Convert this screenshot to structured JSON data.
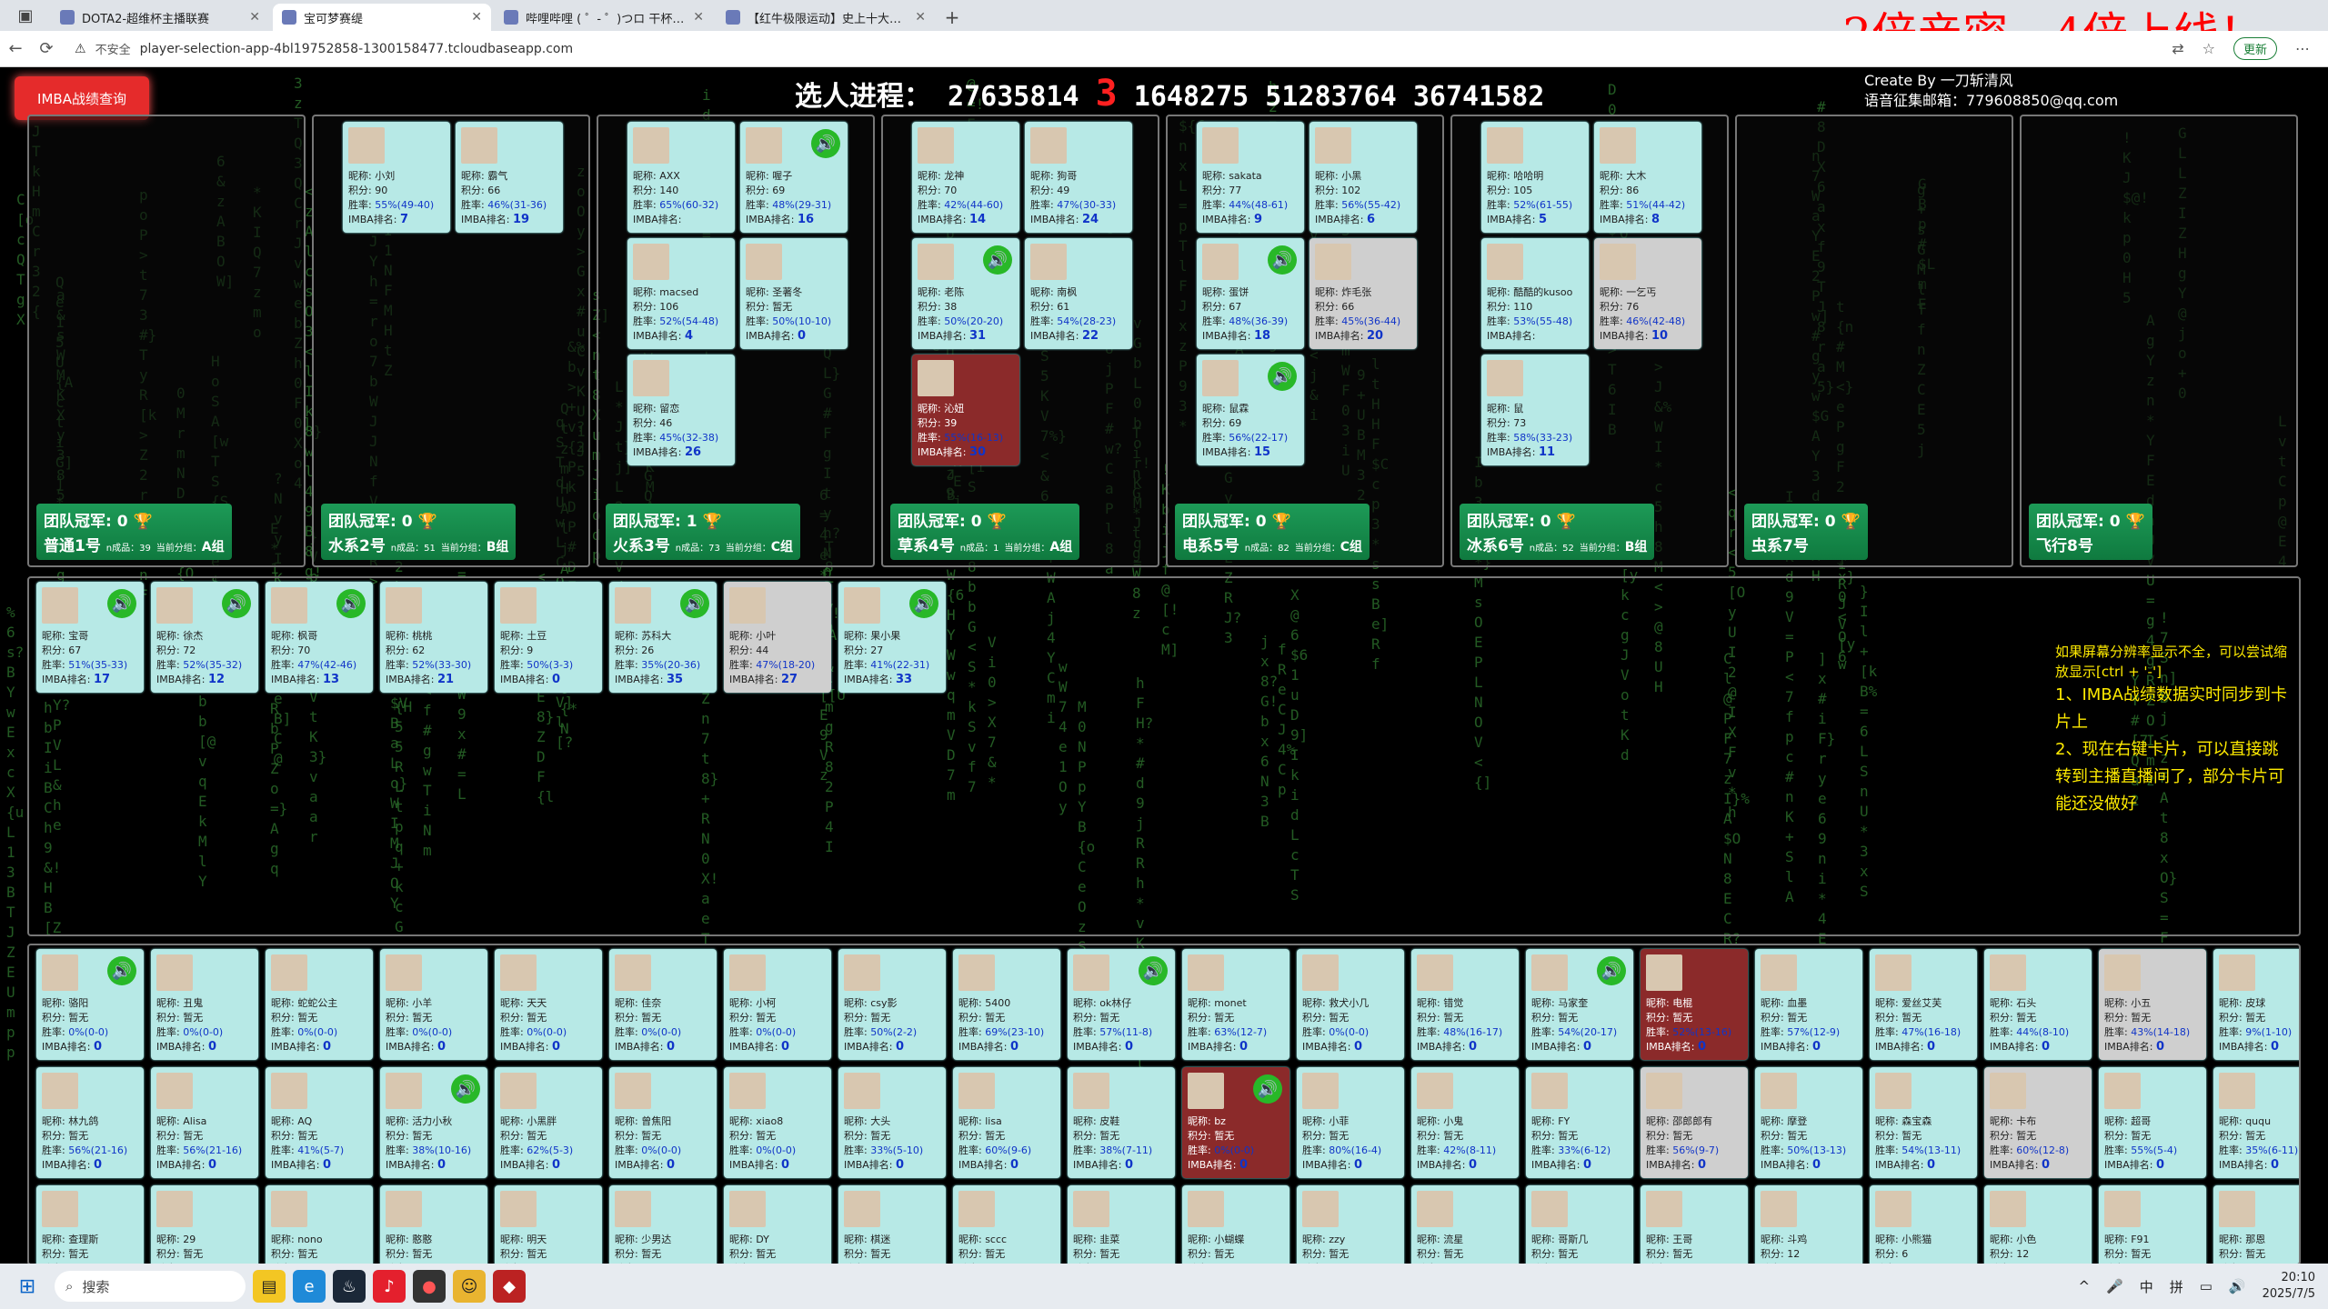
{
  "browser": {
    "tabs": [
      {
        "title": "DOTA2-超维杯主播联赛",
        "active": false
      },
      {
        "title": "宝可梦赛缇",
        "active": true
      },
      {
        "title": "哔哩哔哩 ( ゜- ゜)つロ 干杯~-bilibili",
        "active": false
      },
      {
        "title": "【红牛极限运动】史上十大世界纪录",
        "active": false
      }
    ],
    "new_tab": "+",
    "insecure": "不安全",
    "url": "player-selection-app-4bl19752858-1300158477.tcloudbaseapp.com",
    "update": "更新"
  },
  "overlay": {
    "promo": "2倍亲密，4倍上线！"
  },
  "header": {
    "imba_button": "IMBA战绩查询",
    "progress_label": "选人进程：",
    "progress_a": "27635814",
    "progress_hi": "3",
    "progress_b": "1648275 51283764 36741582",
    "credit1": "Create By 一刀斩清风",
    "credit2": "语音征集邮箱：779608850@qq.com"
  },
  "teams": [
    {
      "champ": "团队冠军: 0",
      "name": "普通1号",
      "score": "39",
      "group": "A组",
      "cards": []
    },
    {
      "champ": "团队冠军: 0",
      "name": "水系2号",
      "score": "51",
      "group": "B组",
      "cards": [
        {
          "n": "小刘",
          "s": "90",
          "w": "55%(49-40)",
          "r": "7"
        },
        {
          "n": "霸气",
          "s": "66",
          "w": "46%(31-36)",
          "r": "19"
        }
      ]
    },
    {
      "champ": "团队冠军: 1",
      "name": "火系3号",
      "score": "73",
      "group": "C组",
      "cards": [
        {
          "n": "AXX",
          "s": "140",
          "w": "65%(60-32)",
          "r": "",
          "spk": false
        },
        {
          "n": "喔子",
          "s": "69",
          "w": "48%(29-31)",
          "r": "16",
          "spk": true
        },
        {
          "n": "macsed",
          "s": "106",
          "w": "52%(54-48)",
          "r": "4"
        },
        {
          "n": "圣著冬",
          "s": "暂无",
          "w": "50%(10-10)",
          "r": "0"
        },
        {
          "n": "留恋",
          "s": "46",
          "w": "45%(32-38)",
          "r": "26"
        }
      ]
    },
    {
      "champ": "团队冠军: 0",
      "name": "草系4号",
      "score": "1",
      "group": "A组",
      "cards": [
        {
          "n": "龙神",
          "s": "70",
          "w": "42%(44-60)",
          "r": "14"
        },
        {
          "n": "狗哥",
          "s": "49",
          "w": "47%(30-33)",
          "r": "24"
        },
        {
          "n": "老陈",
          "s": "38",
          "w": "50%(20-20)",
          "r": "31",
          "spk": true
        },
        {
          "n": "南枫",
          "s": "61",
          "w": "54%(28-23)",
          "r": "22"
        },
        {
          "n": "沁妞",
          "s": "39",
          "w": "55%(16-13)",
          "r": "30",
          "dark": true
        }
      ]
    },
    {
      "champ": "团队冠军: 0",
      "name": "电系5号",
      "score": "82",
      "group": "C组",
      "cards": [
        {
          "n": "sakata",
          "s": "77",
          "w": "44%(48-61)",
          "r": "9"
        },
        {
          "n": "小黑",
          "s": "102",
          "w": "56%(55-42)",
          "r": "6"
        },
        {
          "n": "蛋饼",
          "s": "67",
          "w": "48%(36-39)",
          "r": "18",
          "spk": true
        },
        {
          "n": "炸毛张",
          "s": "66",
          "w": "45%(36-44)",
          "r": "20",
          "gray": true
        },
        {
          "n": "鼠霖",
          "s": "69",
          "w": "56%(22-17)",
          "r": "15",
          "spk": true
        }
      ]
    },
    {
      "champ": "团队冠军: 0",
      "name": "冰系6号",
      "score": "52",
      "group": "B组",
      "cards": [
        {
          "n": "哈哈明",
          "s": "105",
          "w": "52%(61-55)",
          "r": "5"
        },
        {
          "n": "大木",
          "s": "86",
          "w": "51%(44-42)",
          "r": "8"
        },
        {
          "n": "酷酷的kusoo",
          "s": "110",
          "w": "53%(55-48)",
          "r": ""
        },
        {
          "n": "一乞丐",
          "s": "76",
          "w": "46%(42-48)",
          "r": "10",
          "gray": true
        },
        {
          "n": "鼠",
          "s": "73",
          "w": "58%(33-23)",
          "r": "11"
        }
      ]
    },
    {
      "champ": "团队冠军: 0",
      "name": "虫系7号",
      "score": "",
      "group": "",
      "cards": []
    },
    {
      "champ": "团队冠军: 0",
      "name": "飞行8号",
      "score": "",
      "group": "",
      "cards": []
    }
  ],
  "labels": {
    "nick": "昵称: ",
    "score": "积分: ",
    "win": "胜率: ",
    "rank": "IMBA排名: ",
    "score_tag": "n成品：",
    "score_tag2": "当前分组："
  },
  "pool": [
    {
      "n": "宝哥",
      "s": "67",
      "w": "51%(35-33)",
      "r": "17",
      "spk": true
    },
    {
      "n": "徐杰",
      "s": "72",
      "w": "52%(35-32)",
      "r": "12",
      "spk": true
    },
    {
      "n": "枫哥",
      "s": "70",
      "w": "47%(42-46)",
      "r": "13",
      "spk": true
    },
    {
      "n": "桃桃",
      "s": "62",
      "w": "52%(33-30)",
      "r": "21"
    },
    {
      "n": "土豆",
      "s": "9",
      "w": "50%(3-3)",
      "r": "0"
    },
    {
      "n": "苏科大",
      "s": "26",
      "w": "35%(20-36)",
      "r": "35",
      "spk": true
    },
    {
      "n": "小叶",
      "s": "44",
      "w": "47%(18-20)",
      "r": "27",
      "gray": true
    },
    {
      "n": "果小果",
      "s": "27",
      "w": "41%(22-31)",
      "r": "33",
      "spk": true
    }
  ],
  "notes": {
    "hint": "如果屏幕分辨率显示不全，可以尝试缩放显示[ctrl + '-']",
    "n1": "1、IMBA战绩数据实时同步到卡片上",
    "n2": "2、现在右键卡片，可以直接跳转到主播直播间了，部分卡片可能还没做好"
  },
  "available": [
    {
      "n": "骆阳",
      "s": "暂无",
      "w": "0%(0-0)",
      "r": "0",
      "spk": true
    },
    {
      "n": "丑鬼",
      "s": "暂无",
      "w": "0%(0-0)",
      "r": "0"
    },
    {
      "n": "蛇蛇公主",
      "s": "暂无",
      "w": "0%(0-0)",
      "r": "0"
    },
    {
      "n": "小羊",
      "s": "暂无",
      "w": "0%(0-0)",
      "r": "0"
    },
    {
      "n": "天天",
      "s": "暂无",
      "w": "0%(0-0)",
      "r": "0"
    },
    {
      "n": "佳奈",
      "s": "暂无",
      "w": "0%(0-0)",
      "r": "0"
    },
    {
      "n": "小柯",
      "s": "暂无",
      "w": "0%(0-0)",
      "r": "0"
    },
    {
      "n": "csy影",
      "s": "暂无",
      "w": "50%(2-2)",
      "r": "0"
    },
    {
      "n": "5400",
      "s": "暂无",
      "w": "69%(23-10)",
      "r": "0"
    },
    {
      "n": "ok林仔",
      "s": "暂无",
      "w": "57%(11-8)",
      "r": "0",
      "spk": true
    },
    {
      "n": "monet",
      "s": "暂无",
      "w": "63%(12-7)",
      "r": "0"
    },
    {
      "n": "救犬小几",
      "s": "暂无",
      "w": "0%(0-0)",
      "r": "0"
    },
    {
      "n": "错觉",
      "s": "暂无",
      "w": "48%(16-17)",
      "r": "0"
    },
    {
      "n": "马家奎",
      "s": "暂无",
      "w": "54%(20-17)",
      "r": "0",
      "spk": true
    },
    {
      "n": "电棍",
      "s": "暂无",
      "w": "52%(13-16)",
      "r": "0",
      "dark": true
    },
    {
      "n": "血墨",
      "s": "暂无",
      "w": "57%(12-9)",
      "r": "0"
    },
    {
      "n": "爱丝艾芙",
      "s": "暂无",
      "w": "47%(16-18)",
      "r": "0"
    },
    {
      "n": "石头",
      "s": "暂无",
      "w": "44%(8-10)",
      "r": "0"
    },
    {
      "n": "小五",
      "s": "暂无",
      "w": "43%(14-18)",
      "r": "0",
      "gray": true
    },
    {
      "n": "皮球",
      "s": "暂无",
      "w": "9%(1-10)",
      "r": "0"
    },
    {
      "n": "林九鸽",
      "s": "暂无",
      "w": "56%(21-16)",
      "r": "0"
    },
    {
      "n": "Alisa",
      "s": "暂无",
      "w": "56%(21-16)",
      "r": "0"
    },
    {
      "n": "AQ",
      "s": "暂无",
      "w": "41%(5-7)",
      "r": "0"
    },
    {
      "n": "活力小秋",
      "s": "暂无",
      "w": "38%(10-16)",
      "r": "0",
      "spk": true
    },
    {
      "n": "小黑胖",
      "s": "暂无",
      "w": "62%(5-3)",
      "r": "0"
    },
    {
      "n": "曾焦阳",
      "s": "暂无",
      "w": "0%(0-0)",
      "r": "0"
    },
    {
      "n": "xiao8",
      "s": "暂无",
      "w": "0%(0-0)",
      "r": "0"
    },
    {
      "n": "大头",
      "s": "暂无",
      "w": "33%(5-10)",
      "r": "0"
    },
    {
      "n": "lisa",
      "s": "暂无",
      "w": "60%(9-6)",
      "r": "0"
    },
    {
      "n": "皮鞋",
      "s": "暂无",
      "w": "38%(7-11)",
      "r": "0"
    },
    {
      "n": "bz",
      "s": "暂无",
      "w": "0%(0-0)",
      "r": "0",
      "dark": true,
      "spk": true
    },
    {
      "n": "小菲",
      "s": "暂无",
      "w": "80%(16-4)",
      "r": "0"
    },
    {
      "n": "小鬼",
      "s": "暂无",
      "w": "42%(8-11)",
      "r": "0"
    },
    {
      "n": "FY",
      "s": "暂无",
      "w": "33%(6-12)",
      "r": "0"
    },
    {
      "n": "邵郎郎有",
      "s": "暂无",
      "w": "56%(9-7)",
      "r": "0",
      "gray": true
    },
    {
      "n": "摩登",
      "s": "暂无",
      "w": "50%(13-13)",
      "r": "0"
    },
    {
      "n": "森宝森",
      "s": "暂无",
      "w": "54%(13-11)",
      "r": "0"
    },
    {
      "n": "卡布",
      "s": "暂无",
      "w": "60%(12-8)",
      "r": "0",
      "gray": true
    },
    {
      "n": "超哥",
      "s": "暂无",
      "w": "55%(5-4)",
      "r": "0"
    },
    {
      "n": "ququ",
      "s": "暂无",
      "w": "35%(6-11)",
      "r": "0"
    },
    {
      "n": "查理斯",
      "s": "暂无",
      "w": "",
      "r": ""
    },
    {
      "n": "29",
      "s": "暂无",
      "w": "",
      "r": ""
    },
    {
      "n": "nono",
      "s": "暂无",
      "w": "",
      "r": ""
    },
    {
      "n": "憨憨",
      "s": "暂无",
      "w": "",
      "r": ""
    },
    {
      "n": "明天",
      "s": "暂无",
      "w": "",
      "r": ""
    },
    {
      "n": "少男达",
      "s": "暂无",
      "w": "",
      "r": ""
    },
    {
      "n": "DY",
      "s": "暂无",
      "w": "",
      "r": ""
    },
    {
      "n": "棋迷",
      "s": "暂无",
      "w": "",
      "r": ""
    },
    {
      "n": "sccc",
      "s": "暂无",
      "w": "",
      "r": ""
    },
    {
      "n": "韭菜",
      "s": "暂无",
      "w": "",
      "r": ""
    },
    {
      "n": "小蝴蝶",
      "s": "暂无",
      "w": "",
      "r": ""
    },
    {
      "n": "zzy",
      "s": "暂无",
      "w": "",
      "r": ""
    },
    {
      "n": "流星",
      "s": "暂无",
      "w": "",
      "r": ""
    },
    {
      "n": "哥斯几",
      "s": "暂无",
      "w": "",
      "r": ""
    },
    {
      "n": "王哥",
      "s": "暂无",
      "w": "",
      "r": ""
    },
    {
      "n": "斗鸡",
      "s": "12",
      "w": "",
      "r": ""
    },
    {
      "n": "小熊猫",
      "s": "6",
      "w": "",
      "r": ""
    },
    {
      "n": "小色",
      "s": "12",
      "w": "",
      "r": ""
    },
    {
      "n": "F91",
      "s": "暂无",
      "w": "",
      "r": ""
    },
    {
      "n": "那恩",
      "s": "暂无",
      "w": "",
      "r": ""
    }
  ],
  "taskbar": {
    "search": "搜索",
    "ime1": "中",
    "ime2": "拼",
    "time": "20:10",
    "date": "2025/7/5"
  }
}
